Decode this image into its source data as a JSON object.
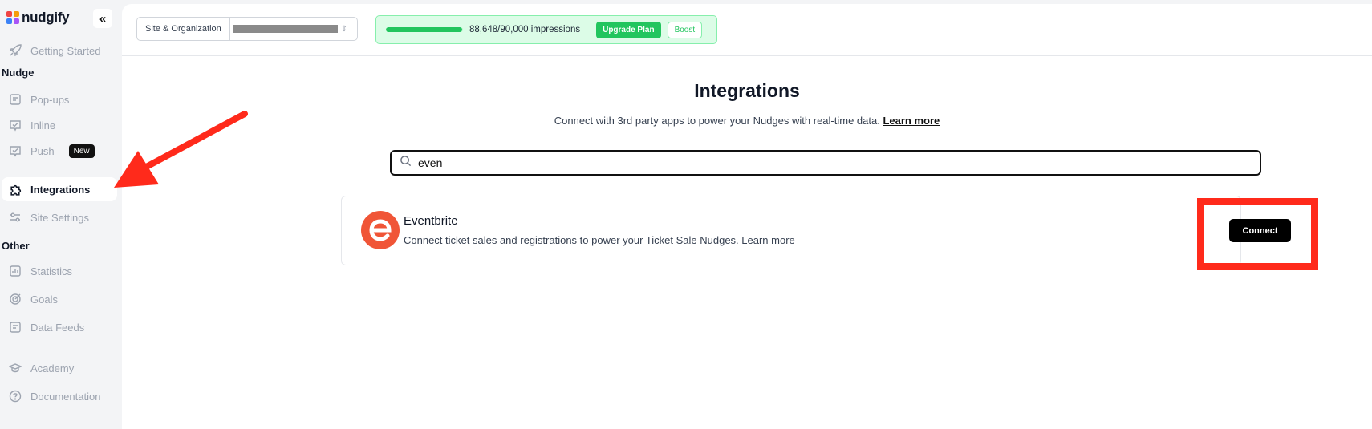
{
  "brand": {
    "name": "nudgify",
    "logo_colors": [
      "#ef4444",
      "#f59e0b",
      "#3b82f6",
      "#a855f7"
    ]
  },
  "sidebar": {
    "collapse_icon": "chevrons-left-icon",
    "items": [
      {
        "label": "Getting Started",
        "icon": "rocket-icon"
      },
      {
        "label": "Pop-ups",
        "icon": "popup-icon"
      },
      {
        "label": "Inline",
        "icon": "inline-check-icon"
      },
      {
        "label": "Push",
        "icon": "push-check-icon",
        "badge": "New"
      },
      {
        "label": "Integrations",
        "icon": "puzzle-icon",
        "active": true
      },
      {
        "label": "Site Settings",
        "icon": "sliders-icon"
      },
      {
        "label": "Statistics",
        "icon": "chart-icon"
      },
      {
        "label": "Goals",
        "icon": "target-icon"
      },
      {
        "label": "Data Feeds",
        "icon": "feed-icon"
      },
      {
        "label": "Academy",
        "icon": "graduation-cap-icon"
      },
      {
        "label": "Documentation",
        "icon": "help-circle-icon"
      }
    ],
    "sections": {
      "nudge": "Nudge",
      "other": "Other"
    }
  },
  "topbar": {
    "site_label": "Site & Organization",
    "usage_text": "88,648/90,000 impressions",
    "usage_fraction": 0.985,
    "upgrade_label": "Upgrade Plan",
    "boost_label": "Boost"
  },
  "page": {
    "title": "Integrations",
    "subtitle": "Connect with 3rd party apps to power your Nudges with real-time data.",
    "subtitle_link": "Learn more"
  },
  "search": {
    "value": "even",
    "icon": "search-icon"
  },
  "results": [
    {
      "name": "Eventbrite",
      "description": "Connect ticket sales and registrations to power your Ticket Sale Nudges. Learn more",
      "action_label": "Connect",
      "logo_color": "#f05537"
    }
  ],
  "annotation": {
    "color": "#ff2a1b"
  }
}
